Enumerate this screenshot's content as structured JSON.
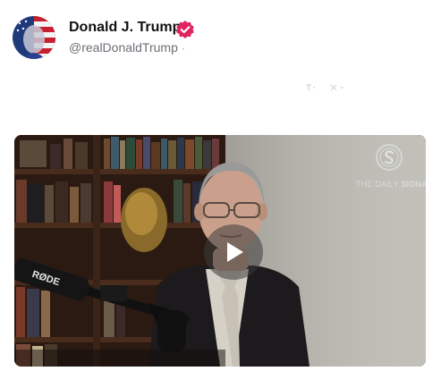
{
  "post": {
    "author": {
      "display_name": "Donald J. Trump",
      "handle": "@realDonaldTrump",
      "handle_separator": "·",
      "verified_color": "#e0245e"
    },
    "media": {
      "type": "video",
      "brand_watermark_light": "THE DAILY",
      "brand_watermark_bold": "SIGNAL",
      "mic_brand": "RØDE"
    }
  }
}
